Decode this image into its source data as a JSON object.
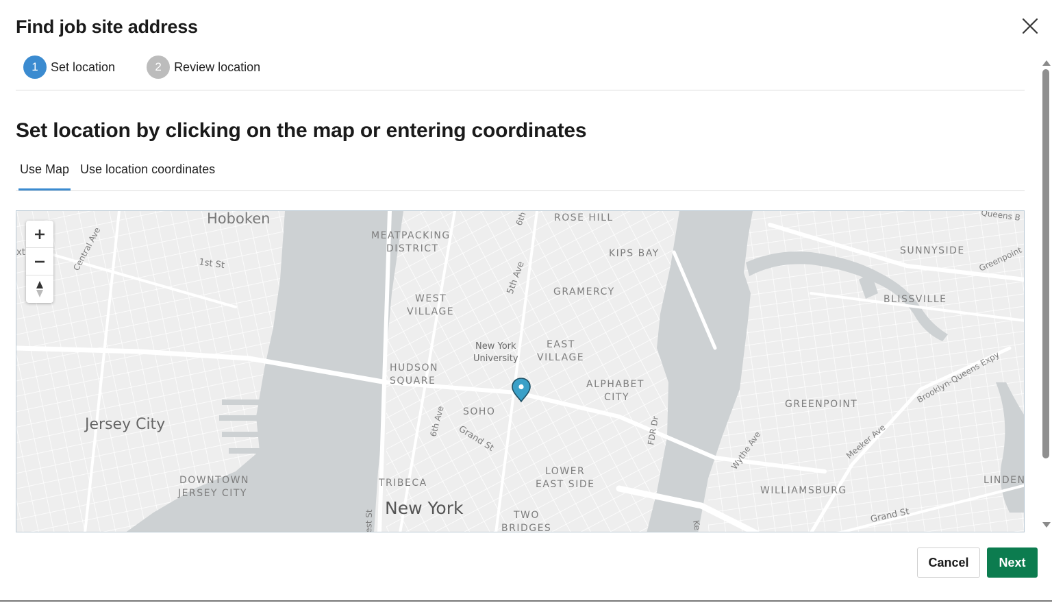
{
  "dialog": {
    "title": "Find job site address"
  },
  "stepper": {
    "steps": [
      {
        "number": "1",
        "label": "Set location",
        "state": "active"
      },
      {
        "number": "2",
        "label": "Review location",
        "state": "inactive"
      }
    ]
  },
  "main": {
    "heading": "Set location by clicking on the map or entering coordinates",
    "tabs": [
      {
        "label": "Use Map",
        "active": true
      },
      {
        "label": "Use location coordinates",
        "active": false
      }
    ]
  },
  "map": {
    "labels": {
      "hoboken": "Hoboken",
      "central_ave": "Central Ave",
      "first_st": "1st St",
      "xt": "xt",
      "meatpacking": [
        "MEATPACKING",
        "DISTRICT"
      ],
      "sixth": "6th",
      "rose_hill": "ROSE HILL",
      "kips_bay": "KIPS BAY",
      "queens_b": "Queens B",
      "sunnyside": "SUNNYSIDE",
      "greenpoint_ave": "Greenpoint",
      "fifth_ave": "5th Ave",
      "gramercy": "GRAMERCY",
      "west_village": [
        "WEST",
        "VILLAGE"
      ],
      "blissville": "BLISSVILLE",
      "nyu": [
        "New York",
        "University"
      ],
      "east_village": [
        "EAST",
        "VILLAGE"
      ],
      "hudson_square": [
        "HUDSON",
        "SQUARE"
      ],
      "alphabet_city": [
        "ALPHABET",
        "CITY"
      ],
      "bqe": "Brooklyn-Queens Expy",
      "soho": "SOHO",
      "sixth_ave": "6th Ave",
      "grand_st_west": "Grand St",
      "fdr_dr": "FDR Dr",
      "greenpoint": "GREENPOINT",
      "jersey_city": "Jersey City",
      "wythe_ave": "Wythe Ave",
      "meeker_ave": "Meeker Ave",
      "downtown_jc": [
        "DOWNTOWN",
        "JERSEY CITY"
      ],
      "tribeca": "TRIBECA",
      "lower_east_side": [
        "LOWER",
        "EAST SIDE"
      ],
      "linden": "LINDEN",
      "williamsburg": "WILLIAMSBURG",
      "new_york": "New York",
      "grand_st_east": "Grand St",
      "two_bridges": [
        "TWO",
        "BRIDGES"
      ],
      "west_st": "est St",
      "ke": "Ke"
    },
    "controls": {
      "zoom_in": "zoom-in",
      "zoom_out": "zoom-out",
      "compass": "reset-north"
    },
    "colors": {
      "water": "#cdd1d3",
      "land": "#eeeeee",
      "road": "#ffffff",
      "pin": "#3aa0c8"
    }
  },
  "footer": {
    "cancel_label": "Cancel",
    "next_label": "Next"
  },
  "colors": {
    "accent": "#3b8bd0",
    "primary_button": "#0c7c4f",
    "step_inactive": "#bcbcbc"
  }
}
